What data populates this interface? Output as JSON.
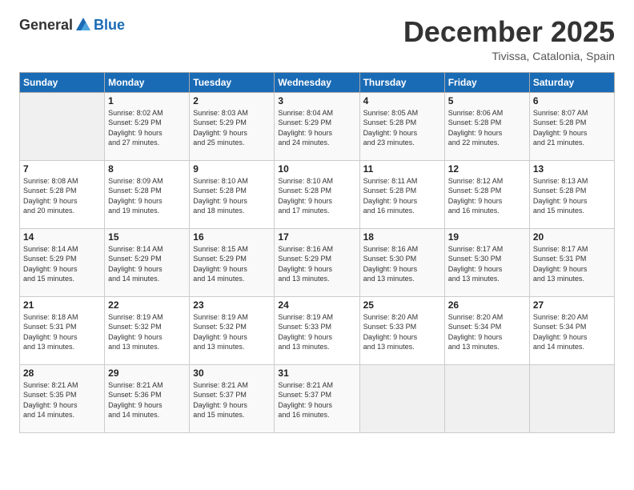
{
  "logo": {
    "general": "General",
    "blue": "Blue"
  },
  "title": "December 2025",
  "location": "Tivissa, Catalonia, Spain",
  "headers": [
    "Sunday",
    "Monday",
    "Tuesday",
    "Wednesday",
    "Thursday",
    "Friday",
    "Saturday"
  ],
  "weeks": [
    [
      {
        "day": "",
        "info": ""
      },
      {
        "day": "1",
        "info": "Sunrise: 8:02 AM\nSunset: 5:29 PM\nDaylight: 9 hours\nand 27 minutes."
      },
      {
        "day": "2",
        "info": "Sunrise: 8:03 AM\nSunset: 5:29 PM\nDaylight: 9 hours\nand 25 minutes."
      },
      {
        "day": "3",
        "info": "Sunrise: 8:04 AM\nSunset: 5:29 PM\nDaylight: 9 hours\nand 24 minutes."
      },
      {
        "day": "4",
        "info": "Sunrise: 8:05 AM\nSunset: 5:28 PM\nDaylight: 9 hours\nand 23 minutes."
      },
      {
        "day": "5",
        "info": "Sunrise: 8:06 AM\nSunset: 5:28 PM\nDaylight: 9 hours\nand 22 minutes."
      },
      {
        "day": "6",
        "info": "Sunrise: 8:07 AM\nSunset: 5:28 PM\nDaylight: 9 hours\nand 21 minutes."
      }
    ],
    [
      {
        "day": "7",
        "info": "Sunrise: 8:08 AM\nSunset: 5:28 PM\nDaylight: 9 hours\nand 20 minutes."
      },
      {
        "day": "8",
        "info": "Sunrise: 8:09 AM\nSunset: 5:28 PM\nDaylight: 9 hours\nand 19 minutes."
      },
      {
        "day": "9",
        "info": "Sunrise: 8:10 AM\nSunset: 5:28 PM\nDaylight: 9 hours\nand 18 minutes."
      },
      {
        "day": "10",
        "info": "Sunrise: 8:10 AM\nSunset: 5:28 PM\nDaylight: 9 hours\nand 17 minutes."
      },
      {
        "day": "11",
        "info": "Sunrise: 8:11 AM\nSunset: 5:28 PM\nDaylight: 9 hours\nand 16 minutes."
      },
      {
        "day": "12",
        "info": "Sunrise: 8:12 AM\nSunset: 5:28 PM\nDaylight: 9 hours\nand 16 minutes."
      },
      {
        "day": "13",
        "info": "Sunrise: 8:13 AM\nSunset: 5:28 PM\nDaylight: 9 hours\nand 15 minutes."
      }
    ],
    [
      {
        "day": "14",
        "info": "Sunrise: 8:14 AM\nSunset: 5:29 PM\nDaylight: 9 hours\nand 15 minutes."
      },
      {
        "day": "15",
        "info": "Sunrise: 8:14 AM\nSunset: 5:29 PM\nDaylight: 9 hours\nand 14 minutes."
      },
      {
        "day": "16",
        "info": "Sunrise: 8:15 AM\nSunset: 5:29 PM\nDaylight: 9 hours\nand 14 minutes."
      },
      {
        "day": "17",
        "info": "Sunrise: 8:16 AM\nSunset: 5:29 PM\nDaylight: 9 hours\nand 13 minutes."
      },
      {
        "day": "18",
        "info": "Sunrise: 8:16 AM\nSunset: 5:30 PM\nDaylight: 9 hours\nand 13 minutes."
      },
      {
        "day": "19",
        "info": "Sunrise: 8:17 AM\nSunset: 5:30 PM\nDaylight: 9 hours\nand 13 minutes."
      },
      {
        "day": "20",
        "info": "Sunrise: 8:17 AM\nSunset: 5:31 PM\nDaylight: 9 hours\nand 13 minutes."
      }
    ],
    [
      {
        "day": "21",
        "info": "Sunrise: 8:18 AM\nSunset: 5:31 PM\nDaylight: 9 hours\nand 13 minutes."
      },
      {
        "day": "22",
        "info": "Sunrise: 8:19 AM\nSunset: 5:32 PM\nDaylight: 9 hours\nand 13 minutes."
      },
      {
        "day": "23",
        "info": "Sunrise: 8:19 AM\nSunset: 5:32 PM\nDaylight: 9 hours\nand 13 minutes."
      },
      {
        "day": "24",
        "info": "Sunrise: 8:19 AM\nSunset: 5:33 PM\nDaylight: 9 hours\nand 13 minutes."
      },
      {
        "day": "25",
        "info": "Sunrise: 8:20 AM\nSunset: 5:33 PM\nDaylight: 9 hours\nand 13 minutes."
      },
      {
        "day": "26",
        "info": "Sunrise: 8:20 AM\nSunset: 5:34 PM\nDaylight: 9 hours\nand 13 minutes."
      },
      {
        "day": "27",
        "info": "Sunrise: 8:20 AM\nSunset: 5:34 PM\nDaylight: 9 hours\nand 14 minutes."
      }
    ],
    [
      {
        "day": "28",
        "info": "Sunrise: 8:21 AM\nSunset: 5:35 PM\nDaylight: 9 hours\nand 14 minutes."
      },
      {
        "day": "29",
        "info": "Sunrise: 8:21 AM\nSunset: 5:36 PM\nDaylight: 9 hours\nand 14 minutes."
      },
      {
        "day": "30",
        "info": "Sunrise: 8:21 AM\nSunset: 5:37 PM\nDaylight: 9 hours\nand 15 minutes."
      },
      {
        "day": "31",
        "info": "Sunrise: 8:21 AM\nSunset: 5:37 PM\nDaylight: 9 hours\nand 16 minutes."
      },
      {
        "day": "",
        "info": ""
      },
      {
        "day": "",
        "info": ""
      },
      {
        "day": "",
        "info": ""
      }
    ]
  ]
}
